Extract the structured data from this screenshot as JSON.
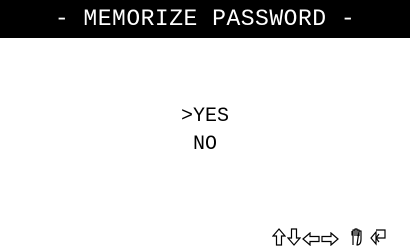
{
  "screen": {
    "title": "- MEMORIZE PASSWORD -",
    "menu": {
      "items": [
        {
          "cursor": ">",
          "label": "YES",
          "selected": true
        },
        {
          "cursor": "",
          "label": "NO",
          "selected": false
        }
      ]
    },
    "nav_icons": [
      "up-arrow-icon",
      "down-arrow-icon",
      "left-arrow-icon",
      "right-arrow-icon",
      "hand-select-icon",
      "return-arrow-icon"
    ]
  }
}
